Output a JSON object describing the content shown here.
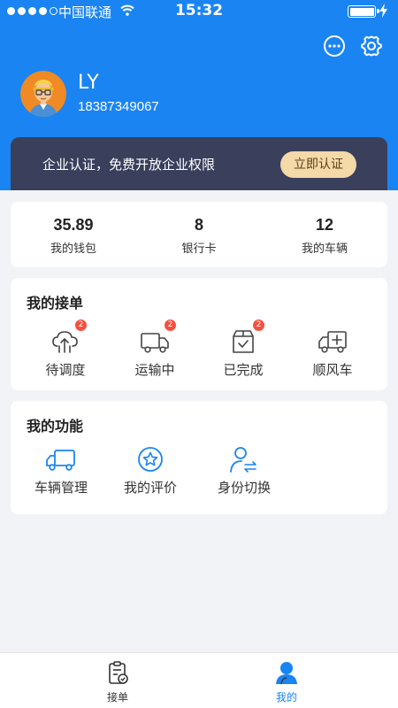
{
  "status_bar": {
    "carrier": "中国联通",
    "time": "15:32"
  },
  "profile": {
    "name": "LY",
    "phone": "18387349067"
  },
  "banner": {
    "text": "企业认证，免费开放企业权限",
    "button": "立即认证"
  },
  "stats": [
    {
      "value": "35.89",
      "label": "我的钱包"
    },
    {
      "value": "8",
      "label": "银行卡"
    },
    {
      "value": "12",
      "label": "我的车辆"
    }
  ],
  "orders": {
    "title": "我的接单",
    "items": [
      {
        "label": "待调度",
        "icon": "upload-route-icon",
        "badge": "2"
      },
      {
        "label": "运输中",
        "icon": "truck-icon",
        "badge": "2"
      },
      {
        "label": "已完成",
        "icon": "box-check-icon",
        "badge": "2"
      },
      {
        "label": "顺风车",
        "icon": "truck-plus-icon"
      }
    ]
  },
  "features": {
    "title": "我的功能",
    "items": [
      {
        "label": "车辆管理",
        "icon": "truck-outline-icon"
      },
      {
        "label": "我的评价",
        "icon": "star-circle-icon"
      },
      {
        "label": "身份切换",
        "icon": "user-switch-icon"
      }
    ]
  },
  "tabbar": {
    "items": [
      {
        "label": "接单",
        "icon": "clipboard-check-icon"
      },
      {
        "label": "我的",
        "icon": "user-icon"
      }
    ]
  },
  "colors": {
    "primary": "#1a84f3",
    "banner": "#3a3f5c",
    "banner_button": "#f4d9a9",
    "badge": "#f5503f",
    "background": "#f2f3f7"
  }
}
